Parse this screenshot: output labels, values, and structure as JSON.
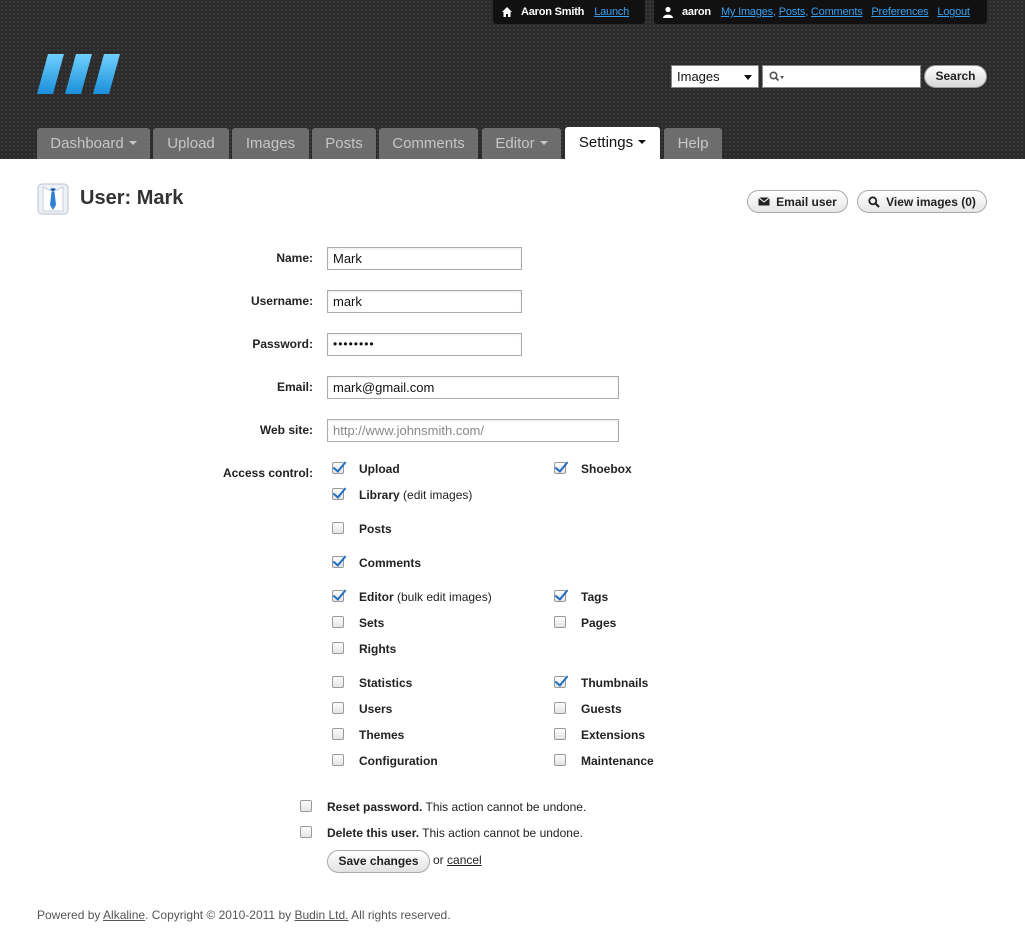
{
  "top_bar": {
    "site_name": "Aaron Smith",
    "launch_link": "Launch",
    "username": "aaron",
    "links": [
      "My Images",
      "Posts",
      "Comments",
      "Preferences",
      "Logout"
    ]
  },
  "search": {
    "scope": "Images",
    "query": "",
    "button": "Search"
  },
  "tabs": [
    {
      "label": "Dashboard",
      "dropdown": true,
      "active": false
    },
    {
      "label": "Upload",
      "dropdown": false,
      "active": false
    },
    {
      "label": "Images",
      "dropdown": false,
      "active": false
    },
    {
      "label": "Posts",
      "dropdown": false,
      "active": false
    },
    {
      "label": "Comments",
      "dropdown": false,
      "active": false
    },
    {
      "label": "Editor",
      "dropdown": true,
      "active": false
    },
    {
      "label": "Settings",
      "dropdown": true,
      "active": true
    },
    {
      "label": "Help",
      "dropdown": false,
      "active": false
    }
  ],
  "page": {
    "title": "User: Mark",
    "email_button": "Email user",
    "view_images_button": "View images (0)"
  },
  "form": {
    "name_label": "Name:",
    "name_value": "Mark",
    "username_label": "Username:",
    "username_value": "mark",
    "password_label": "Password:",
    "password_value": "••••••••",
    "email_label": "Email:",
    "email_value": "mark@gmail.com",
    "website_label": "Web site:",
    "website_placeholder": "http://www.johnsmith.com/",
    "access_label": "Access control:"
  },
  "access": {
    "upload": {
      "label": "Upload",
      "note": "",
      "checked": true
    },
    "shoebox": {
      "label": "Shoebox",
      "note": "",
      "checked": true
    },
    "library": {
      "label": "Library",
      "note": " (edit images)",
      "checked": true
    },
    "posts": {
      "label": "Posts",
      "note": "",
      "checked": false
    },
    "comments": {
      "label": "Comments",
      "note": "",
      "checked": true
    },
    "editor": {
      "label": "Editor",
      "note": " (bulk edit images)",
      "checked": true
    },
    "tags": {
      "label": "Tags",
      "note": "",
      "checked": true
    },
    "sets": {
      "label": "Sets",
      "note": "",
      "checked": false
    },
    "pages": {
      "label": "Pages",
      "note": "",
      "checked": false
    },
    "rights": {
      "label": "Rights",
      "note": "",
      "checked": false
    },
    "statistics": {
      "label": "Statistics",
      "note": "",
      "checked": false
    },
    "thumbnails": {
      "label": "Thumbnails",
      "note": "",
      "checked": true
    },
    "users": {
      "label": "Users",
      "note": "",
      "checked": false
    },
    "guests": {
      "label": "Guests",
      "note": "",
      "checked": false
    },
    "themes": {
      "label": "Themes",
      "note": "",
      "checked": false
    },
    "extensions": {
      "label": "Extensions",
      "note": "",
      "checked": false
    },
    "configuration": {
      "label": "Configuration",
      "note": "",
      "checked": false
    },
    "maintenance": {
      "label": "Maintenance",
      "note": "",
      "checked": false
    }
  },
  "actions": {
    "reset_label": "Reset password.",
    "reset_note": " This action cannot be undone.",
    "reset_checked": false,
    "delete_label": "Delete this user.",
    "delete_note": " This action cannot be undone.",
    "delete_checked": false,
    "save_button": "Save changes",
    "or_text": "or",
    "cancel_link": "cancel"
  },
  "footer": {
    "powered_by": "Powered by ",
    "alkaline": "Alkaline",
    "copyright": ". Copyright © 2010-2011 by ",
    "budin": "Budin Ltd.",
    "rights": " All rights reserved."
  },
  "colors": {
    "link_blue": "#3aa0f0",
    "logo_blue": "#29a8ec",
    "check_blue": "#1f6fc0",
    "tab_inactive": "#6d6d6d"
  }
}
